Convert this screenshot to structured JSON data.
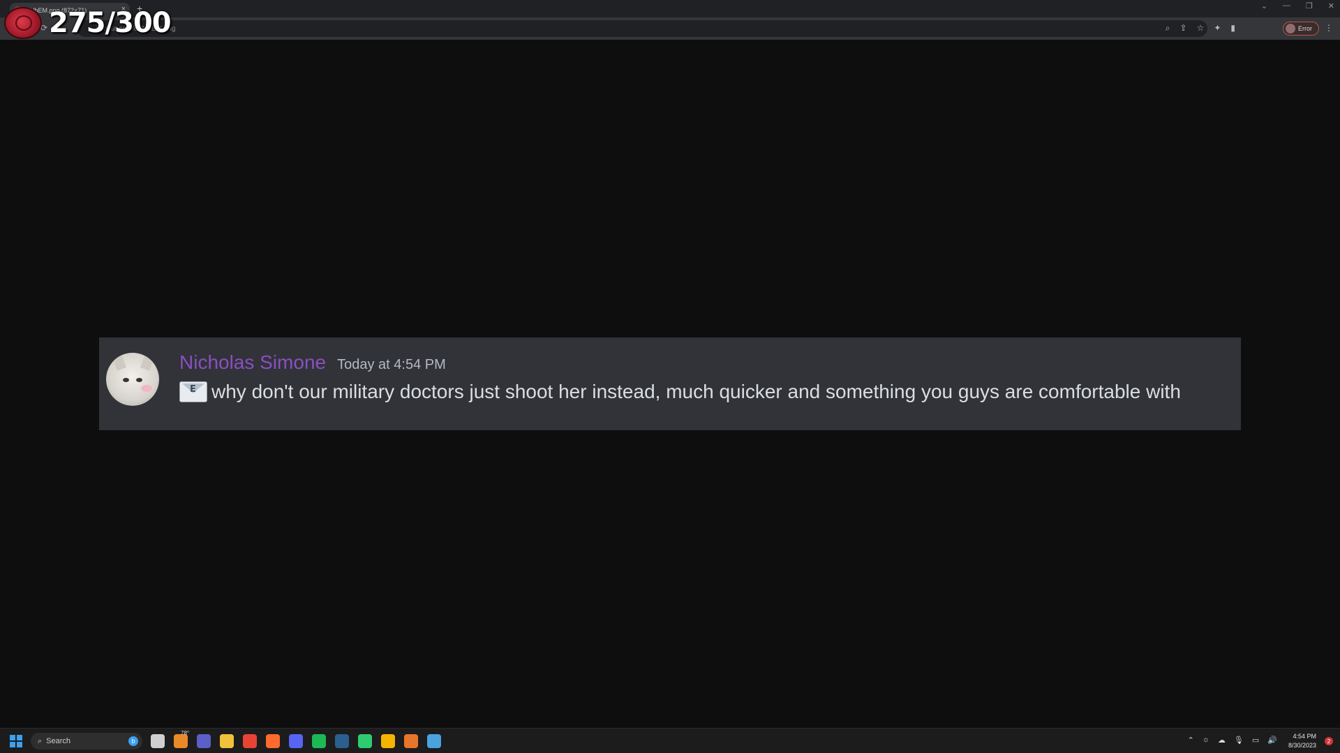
{
  "browser": {
    "tab_title": "oNVbEM.png (872×71)",
    "new_tab": "+",
    "tab_close": "×",
    "address": "i.imgur.com/oNVbEM.png",
    "profile_label": "Error",
    "window_controls": [
      "⌄",
      "—",
      "❐",
      "✕"
    ],
    "omnibox_icons": [
      "zoom-icon",
      "share-icon",
      "star-icon",
      "extensions-icon",
      "sidepanel-icon"
    ]
  },
  "overlay": {
    "counter": "275/300"
  },
  "message": {
    "username": "Nicholas Simone",
    "timestamp": "Today at 4:54 PM",
    "emoji": "envelope-icon",
    "text": "why don't our military doctors just shoot her instead, much quicker and something you guys are comfortable with",
    "colors": {
      "username": "#8a4fc0",
      "card_bg": "#313338"
    }
  },
  "taskbar": {
    "search_placeholder": "Search",
    "weather": "78°",
    "time": "4:54 PM",
    "date": "8/30/2023",
    "notifications": "2",
    "apps": [
      {
        "name": "task-view",
        "color": "#cfcfcf"
      },
      {
        "name": "weather",
        "color": "#e88a2a"
      },
      {
        "name": "teams",
        "color": "#5b5fc7"
      },
      {
        "name": "file-explorer",
        "color": "#f2c13b"
      },
      {
        "name": "chrome",
        "color": "#e94335"
      },
      {
        "name": "firefox",
        "color": "#ff6b2c"
      },
      {
        "name": "discord",
        "color": "#5865f2"
      },
      {
        "name": "spotify",
        "color": "#1db954"
      },
      {
        "name": "steam",
        "color": "#2a5f8f"
      },
      {
        "name": "app-green",
        "color": "#2ecc71"
      },
      {
        "name": "chrome-alt",
        "color": "#f4b400"
      },
      {
        "name": "app-orange",
        "color": "#e8762a"
      },
      {
        "name": "notepad",
        "color": "#4aa3df"
      }
    ]
  }
}
